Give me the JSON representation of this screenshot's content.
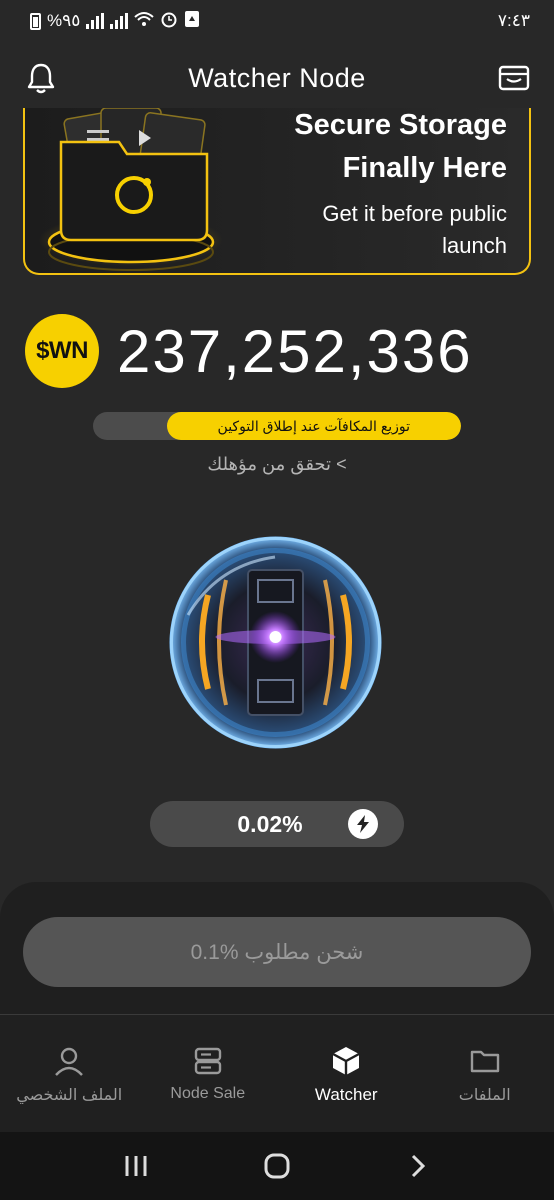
{
  "status_bar": {
    "battery": "%٩٥",
    "time": "٧:٤٣"
  },
  "header": {
    "title": "Watcher Node",
    "left_icon": "bell-icon",
    "right_icon": "wallet-icon"
  },
  "banner": {
    "title_line1": "Secure Storage",
    "title_line2": "Finally Here",
    "subtitle_line1": "Get it before public",
    "subtitle_line2": "launch",
    "accent": "#f3c211"
  },
  "balance": {
    "coin_label": "$WN",
    "value": "237,252,336"
  },
  "reward_bar": {
    "label": "توزيع المكافآت عند إطلاق التوكين"
  },
  "eligibility_link": "تحقق من مؤهلك <",
  "charge": {
    "percent": "0.02%",
    "button_label": "0.1% شحن مطلوب"
  },
  "nav": {
    "items": [
      {
        "label": "الملف الشخصي",
        "icon": "person-icon",
        "active": false
      },
      {
        "label": "Node Sale",
        "icon": "server-icon",
        "active": false
      },
      {
        "label": "Watcher",
        "icon": "cube-icon",
        "active": true
      },
      {
        "label": "الملفات",
        "icon": "folder-icon",
        "active": false
      }
    ]
  },
  "colors": {
    "background": "#282828",
    "accent_yellow": "#f7d000"
  }
}
